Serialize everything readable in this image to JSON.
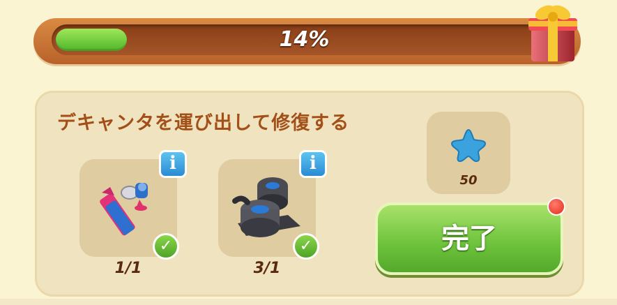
{
  "progress": {
    "percent_value": 14,
    "label": "14%"
  },
  "task": {
    "title": "デキャンタを運び出して修復する",
    "items": [
      {
        "icon": "glue-tube-tools-icon",
        "count": "1/1",
        "completed": true
      },
      {
        "icon": "duct-tape-icon",
        "count": "3/1",
        "completed": true
      }
    ],
    "info_symbol": "i",
    "check_symbol": "✓"
  },
  "reward": {
    "icon": "blue-star-icon",
    "amount": "50"
  },
  "actions": {
    "complete_label": "完了"
  },
  "colors": {
    "progress_fill": "#4fb52a",
    "panel_bg": "#f0e3bf",
    "title_text": "#a24f18",
    "complete_button": "#6cc23b"
  }
}
